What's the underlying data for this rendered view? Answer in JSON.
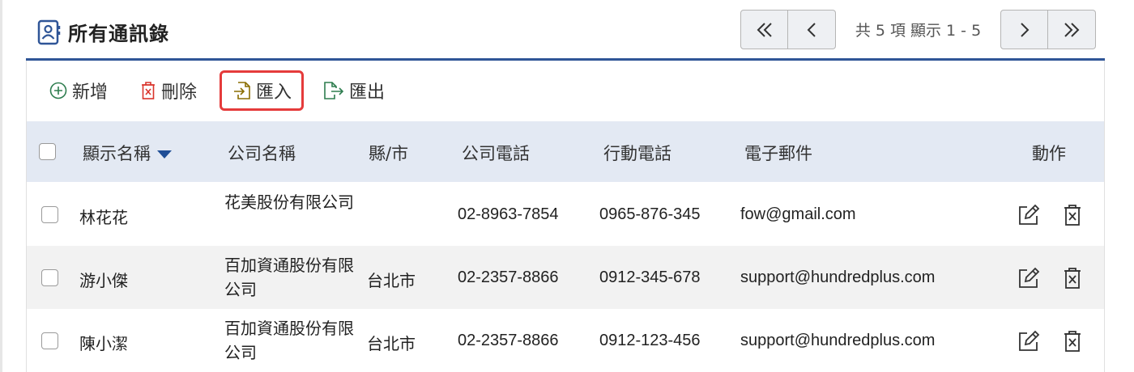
{
  "header": {
    "title": "所有通訊錄",
    "icon": "contact-book-icon",
    "accent_color": "#2f5597"
  },
  "pager": {
    "info": "共 5 項 顯示 1 - 5",
    "first_icon": "double-chevron-left-icon",
    "prev_icon": "chevron-left-icon",
    "next_icon": "chevron-right-icon",
    "last_icon": "double-chevron-right-icon"
  },
  "toolbar": {
    "add_label": "新增",
    "delete_label": "刪除",
    "import_label": "匯入",
    "export_label": "匯出",
    "add_color": "#2e7d4f",
    "delete_color": "#d9342b",
    "import_color": "#8a6d00",
    "export_color": "#2e7d4f",
    "highlight_color": "#e53b3b"
  },
  "table": {
    "columns": {
      "name": "顯示名稱",
      "company": "公司名稱",
      "city": "縣/市",
      "company_phone": "公司電話",
      "mobile": "行動電話",
      "email": "電子郵件",
      "action": "動作"
    },
    "sorted_by": "name",
    "rows": [
      {
        "name": "林花花",
        "company": "花美股份有限公司",
        "city": "",
        "company_phone": "02-8963-7854",
        "mobile": "0965-876-345",
        "email": "fow@gmail.com"
      },
      {
        "name": "游小傑",
        "company": "百加資通股份有限公司",
        "city": "台北市",
        "company_phone": "02-2357-8866",
        "mobile": "0912-345-678",
        "email": "support@hundredplus.com"
      },
      {
        "name": "陳小潔",
        "company": "百加資通股份有限公司",
        "city": "台北市",
        "company_phone": "02-2357-8866",
        "mobile": "0912-123-456",
        "email": "support@hundredplus.com"
      }
    ]
  }
}
